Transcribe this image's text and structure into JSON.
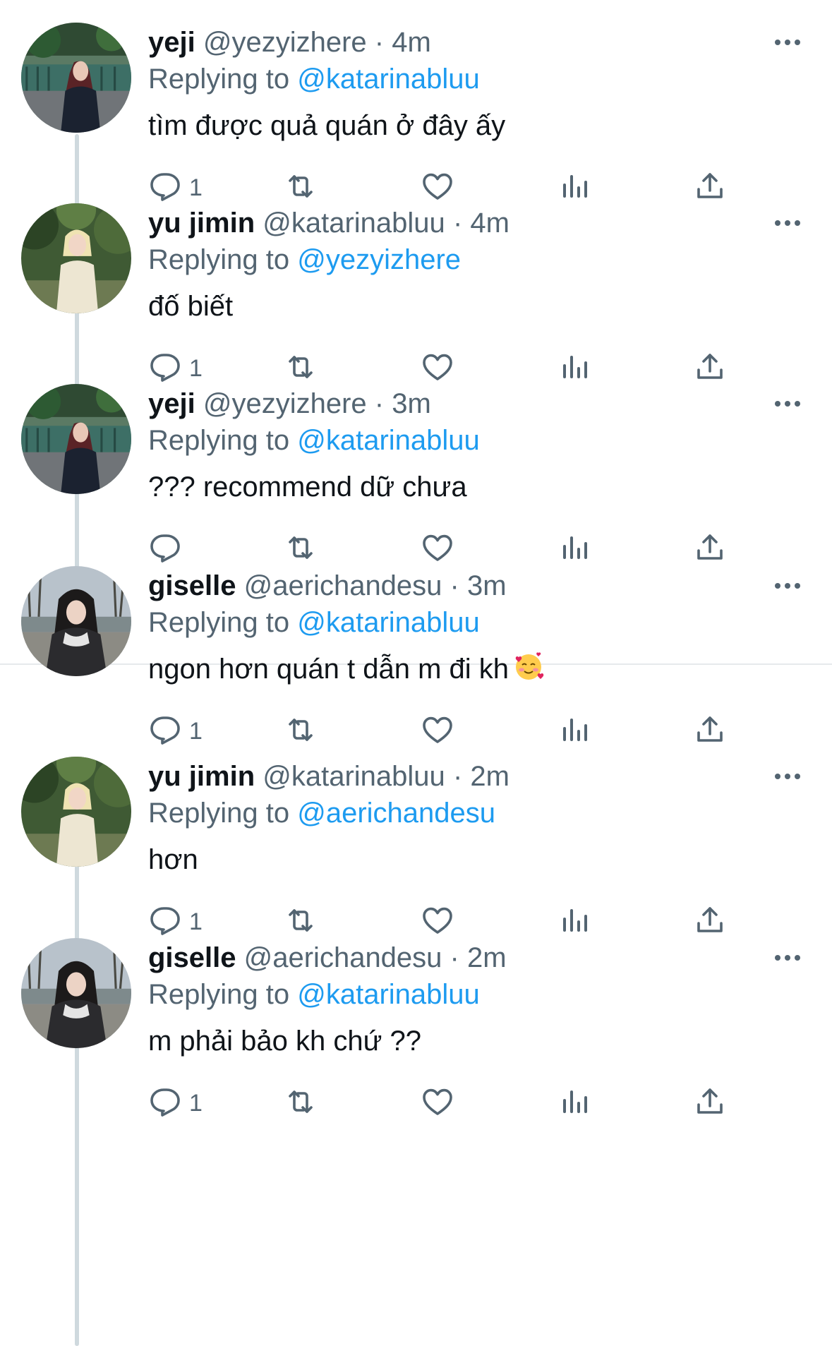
{
  "tweets": [
    {
      "name": "yeji",
      "handle": "@yezyizhere",
      "separator": "·",
      "time": "4m",
      "replying_prefix": "Replying to",
      "replying_to": "@katarinabluu",
      "text": "tìm được quả quán ở đây ấy",
      "reply_count": "1",
      "avatar": "yeji-avatar"
    },
    {
      "name": "yu jimin",
      "handle": "@katarinabluu",
      "separator": "·",
      "time": "4m",
      "replying_prefix": "Replying to",
      "replying_to": "@yezyizhere",
      "text": "đố biết",
      "reply_count": "1",
      "avatar": "yujimin-avatar"
    },
    {
      "name": "yeji",
      "handle": "@yezyizhere",
      "separator": "·",
      "time": "3m",
      "replying_prefix": "Replying to",
      "replying_to": "@katarinabluu",
      "text": "??? recommend dữ chưa",
      "reply_count": "",
      "avatar": "yeji-avatar"
    },
    {
      "name": "giselle",
      "handle": "@aerichandesu",
      "separator": "·",
      "time": "3m",
      "replying_prefix": "Replying to",
      "replying_to": "@katarinabluu",
      "text": "ngon hơn quán t dẫn m đi kh",
      "text_emoji": "smiling-face-with-hearts",
      "reply_count": "1",
      "avatar": "giselle-avatar"
    },
    {
      "name": "yu jimin",
      "handle": "@katarinabluu",
      "separator": "·",
      "time": "2m",
      "replying_prefix": "Replying to",
      "replying_to": "@aerichandesu",
      "text": "hơn",
      "reply_count": "1",
      "avatar": "yujimin-avatar"
    },
    {
      "name": "giselle",
      "handle": "@aerichandesu",
      "separator": "·",
      "time": "2m",
      "replying_prefix": "Replying to",
      "replying_to": "@katarinabluu",
      "text": "m phải bảo kh chứ ??",
      "reply_count": "1",
      "avatar": "giselle-avatar"
    }
  ],
  "icons": {
    "reply": "reply-icon",
    "retweet": "retweet-icon",
    "like": "heart-icon",
    "views": "views-icon",
    "share": "share-icon",
    "more": "more-options-icon"
  },
  "colors": {
    "mention": "#1d9bf0",
    "secondary_text": "#536471",
    "primary_text": "#0f1419",
    "thread_line": "#cfd9de"
  }
}
